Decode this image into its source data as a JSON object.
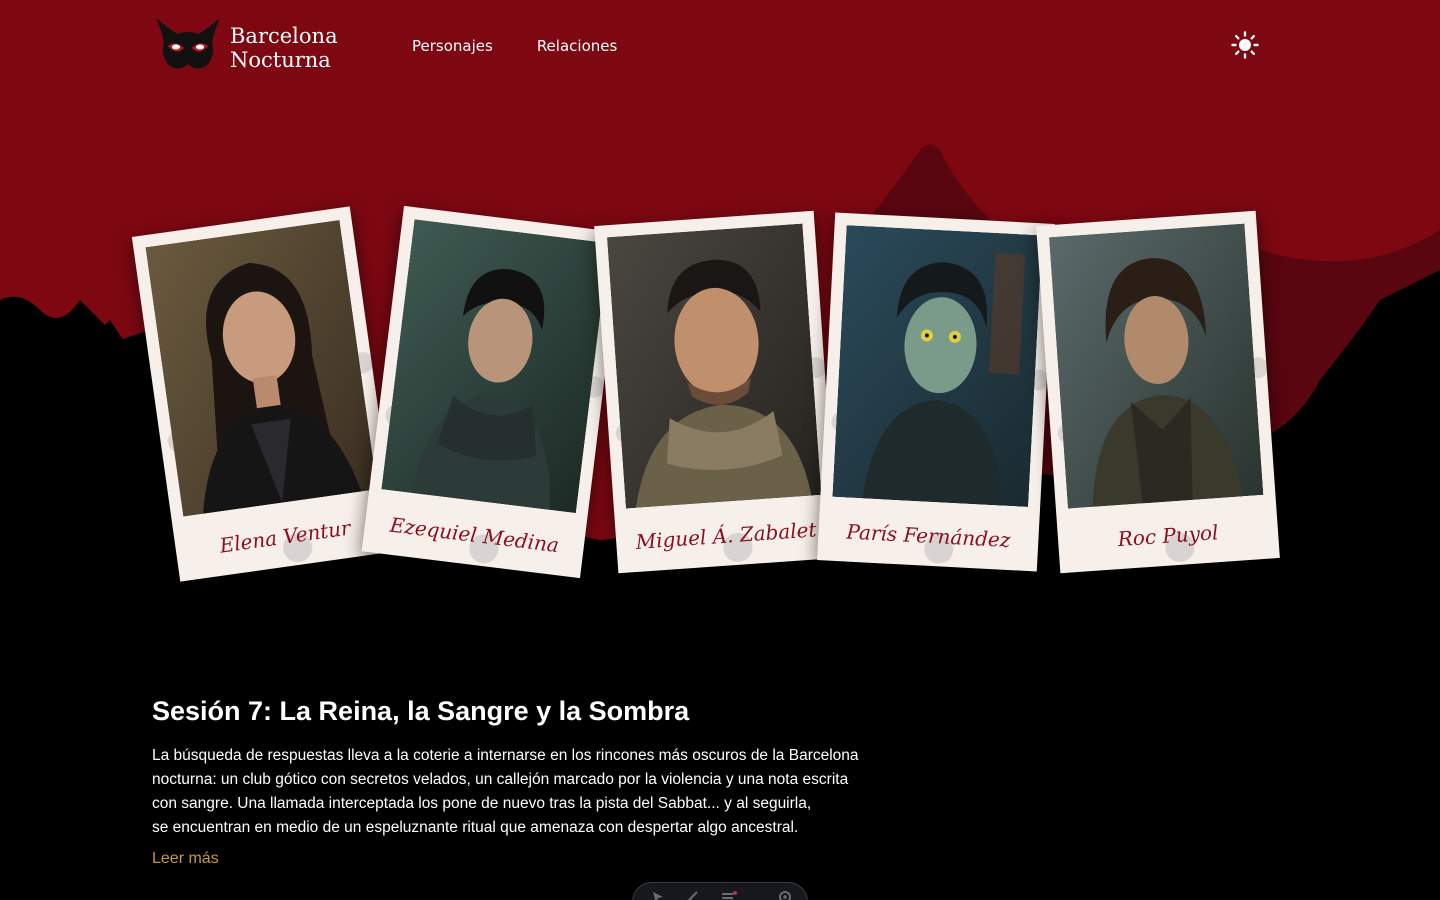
{
  "header": {
    "logo_line1": "Barcelona",
    "logo_line2": "Nocturna",
    "logo_icon": "mask-icon",
    "nav": [
      {
        "label": "Personajes"
      },
      {
        "label": "Relaciones"
      }
    ],
    "theme_toggle_icon": "sun-icon"
  },
  "characters": [
    {
      "name": "Elena Ventura",
      "visible_name": "Elena Ventur"
    },
    {
      "name": "Ezequiel Medina",
      "visible_name": "Ezequiel Medina"
    },
    {
      "name": "Miguel Á. Zabalet",
      "visible_name": "Miguel Á. Zabalet"
    },
    {
      "name": "París Fernández",
      "visible_name": "París Fernández"
    },
    {
      "name": "Roc Puyol",
      "visible_name": "Roc Puyol"
    }
  ],
  "session": {
    "title": "Sesión 7: La Reina, la Sangre y la Sombra",
    "lines": [
      "La búsqueda de respuestas lleva a la coterie a internarse en los rincones más oscuros de la Barcelona",
      "nocturna: un club gótico con secretos velados, un callejón marcado por la violencia y una nota escrita",
      "con sangre. Una llamada interceptada los pone de nuevo tras la pista del Sabbat... y al seguirla,",
      "se encuentran en medio de un espeluznante ritual que amenaza con despertar algo ancestral."
    ],
    "read_more": "Leer más"
  },
  "toolbar": {
    "icons": [
      "cursor-icon",
      "brush-icon",
      "list-icon",
      "settings-icon"
    ]
  },
  "colors": {
    "brand_red": "#7d0812",
    "dark_red": "#5a0610",
    "accent_gold": "#c89b2d",
    "card_name": "#8a1020"
  }
}
